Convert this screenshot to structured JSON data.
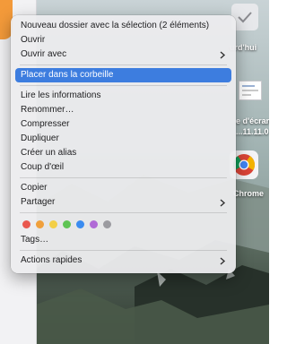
{
  "desktop": {
    "label_aujourdhui": "urd'hui",
    "label_screenshot_1": "e d'écran",
    "label_screenshot_2": "...11.11.0",
    "label_chrome": "Chrome"
  },
  "menu": {
    "items": [
      {
        "label": "Nouveau dossier avec la sélection (2 éléments)"
      },
      {
        "label": "Ouvrir"
      },
      {
        "label": "Ouvrir avec"
      },
      {
        "label": "Placer dans la corbeille"
      },
      {
        "label": "Lire les informations"
      },
      {
        "label": "Renommer…"
      },
      {
        "label": "Compresser"
      },
      {
        "label": "Dupliquer"
      },
      {
        "label": "Créer un alias"
      },
      {
        "label": "Coup d'œil"
      },
      {
        "label": "Copier"
      },
      {
        "label": "Partager"
      },
      {
        "label": "Tags…"
      },
      {
        "label": "Actions rapides"
      }
    ],
    "highlighted_index": 3,
    "highlight_color": "#3d7ddf",
    "tag_colors": [
      {
        "name": "red",
        "color": "#e9584f"
      },
      {
        "name": "orange",
        "color": "#f0a03c"
      },
      {
        "name": "yellow",
        "color": "#f3cf47"
      },
      {
        "name": "green",
        "color": "#5ec454"
      },
      {
        "name": "blue",
        "color": "#3b8cf0"
      },
      {
        "name": "purple",
        "color": "#b06ad6"
      },
      {
        "name": "gray",
        "color": "#9b9ba0"
      }
    ]
  }
}
